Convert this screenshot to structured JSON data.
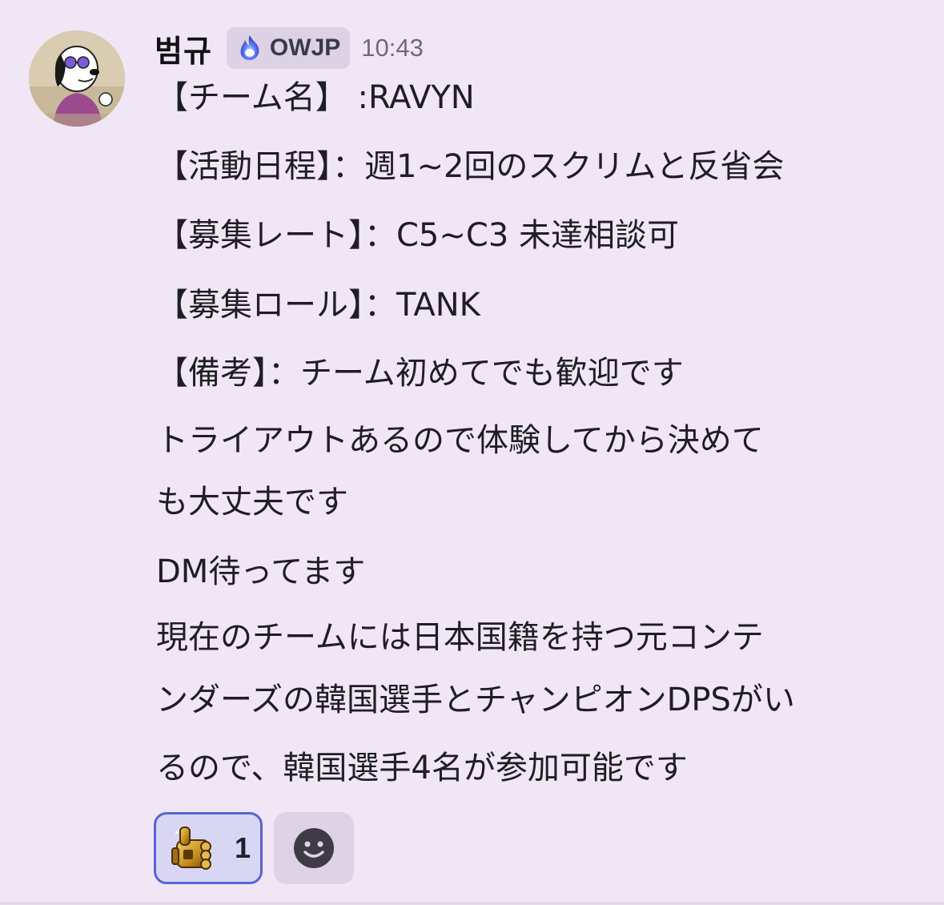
{
  "author": {
    "name": "범규",
    "avatar_icon": "snoopy-avatar-icon"
  },
  "tag": {
    "icon": "blue-flame-icon",
    "label": "OWJP"
  },
  "timestamp": "10:43",
  "message": {
    "lines": [
      "【チーム名】 :RAVYN",
      "【活動日程】：週1~2回のスクリムと反省会",
      "【募集レート】：C5~C3 未達相談可",
      "【募集ロール】：TANK",
      "【備考】：チーム初めてでも歓迎です",
      "トライアウトあるので体験してから決めて",
      "も大丈夫です",
      "DM待ってます",
      "現在のチームには日本国籍を持つ元コンテ",
      "ンダーズの韓国選手とチャンピオンDPSがい",
      "るので、韓国選手4名が参加可能です"
    ]
  },
  "reactions": [
    {
      "icon": "golden-fist-emoji-icon",
      "count": "1",
      "selected": true
    }
  ],
  "add_reaction_icon": "smiley-add-reaction-icon",
  "colors": {
    "background": "#f1e6f5",
    "reaction_border": "#5b63d6",
    "reaction_fill": "#d9d6f4",
    "tag_fill": "#ddd1e6"
  }
}
